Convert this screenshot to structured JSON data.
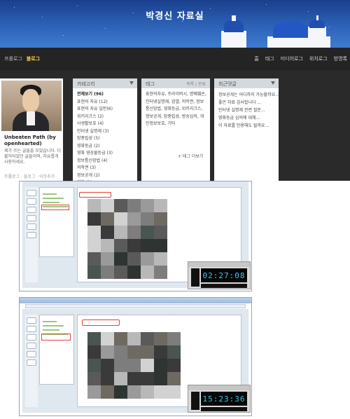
{
  "header": {
    "blog_title": "박경신 자료실"
  },
  "nav": {
    "left": [
      "프롤로그",
      "블로그"
    ],
    "active_index": 1,
    "right": [
      "홈",
      "태그",
      "미디어로그",
      "위치로그",
      "방명록"
    ]
  },
  "profile": {
    "name": "Unbeaten Path (by openhearted)",
    "description": "제가 쓰는 글들을 모았습니다. 다 불허되었던 글들이며, 자유롭게 사용하세요.",
    "links": "프롤로그 · 블로그 · 이웃추가"
  },
  "categories": {
    "title": "카테고리",
    "items": [
      {
        "label": "전체보기 (96)",
        "bold": true
      },
      {
        "label": "표현의 자유 (12)",
        "bold": false
      },
      {
        "label": "표현의 자유 일반(6)",
        "bold": false
      },
      {
        "label": "위키리크스 (2)",
        "bold": false
      },
      {
        "label": "사생활보호 (4)",
        "bold": false
      },
      {
        "label": "인터넷 실명제 (3)",
        "bold": false
      },
      {
        "label": "망중립성 (5)",
        "bold": false
      },
      {
        "label": "영화등급 (2)",
        "bold": false
      },
      {
        "label": "영화 영상물등급 (3)",
        "bold": false
      },
      {
        "label": "정보통신망법 (4)",
        "bold": false
      },
      {
        "label": "저작권 (3)",
        "bold": false
      },
      {
        "label": "정보공개 (2)",
        "bold": false
      },
      {
        "label": "기타 (1)",
        "bold": false
      }
    ]
  },
  "tags": {
    "title": "태그",
    "subtitle": "목록 | 분류",
    "text": "표현의자유, 프라이버시, 명예훼손, 인터넷실명제, 검열, 저작권, 정보통신망법, 영화등급, 위키리크스, 정보공개, 망중립성, 방송심의, 개인정보보호, 기타",
    "more": "+ 태그 더보기"
  },
  "replies": {
    "title": "최근댓글",
    "items": [
      "정보공개는 어디까지 가능할까요...",
      "좋은 자료 감사합니다 ...",
      "인터넷 실명제 관련 질문...",
      "영화등급 심의에 대해...",
      "이 자료를 인용해도 될까요..."
    ]
  },
  "captures": [
    {
      "clock": "02:27:08"
    },
    {
      "clock": "15:23:36"
    }
  ],
  "colors": {
    "banner": "#2d63b8",
    "nav": "#242424",
    "active_nav": "#ffd23a",
    "clock_digits": "#35c8f0",
    "highlight": "#e04040"
  }
}
